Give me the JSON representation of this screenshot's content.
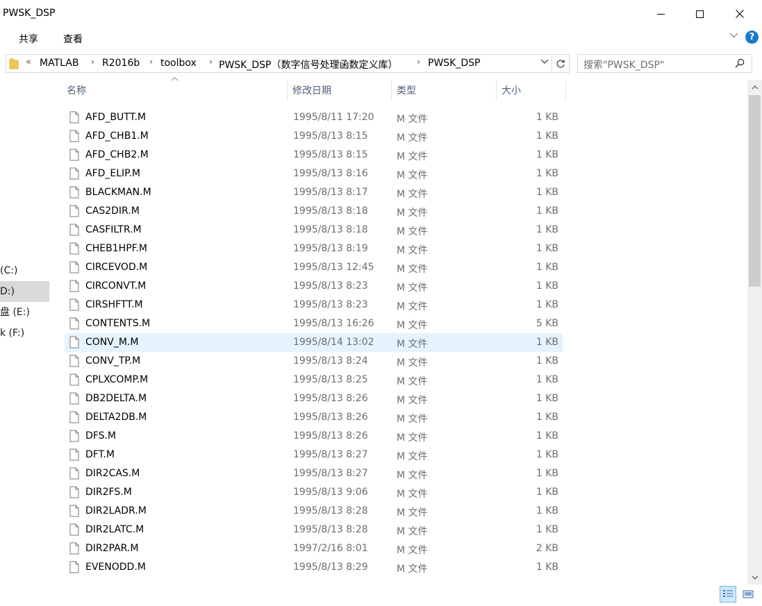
{
  "window": {
    "title": "PWSK_DSP"
  },
  "ribbon": {
    "tabs": [
      "共享",
      "查看"
    ]
  },
  "address": {
    "overflow": "«",
    "crumbs": [
      "MATLAB",
      "R2016b",
      "toolbox",
      "PWSK_DSP（数字信号处理函数定义库）",
      "PWSK_DSP"
    ]
  },
  "search": {
    "placeholder": "搜索\"PWSK_DSP\""
  },
  "nav": {
    "items": [
      {
        "label": " (C:)",
        "selected": false
      },
      {
        "label": "D:)",
        "selected": true
      },
      {
        "label": "盘 (E:)",
        "selected": false
      },
      {
        "label": "k (F:)",
        "selected": false
      }
    ]
  },
  "columns": {
    "name": "名称",
    "date": "修改日期",
    "type": "类型",
    "size": "大小"
  },
  "files": [
    {
      "name": "AFD_BUTT.M",
      "date": "1995/8/11 17:20",
      "type": "M 文件",
      "size": "1 KB"
    },
    {
      "name": "AFD_CHB1.M",
      "date": "1995/8/13 8:15",
      "type": "M 文件",
      "size": "1 KB"
    },
    {
      "name": "AFD_CHB2.M",
      "date": "1995/8/13 8:15",
      "type": "M 文件",
      "size": "1 KB"
    },
    {
      "name": "AFD_ELIP.M",
      "date": "1995/8/13 8:16",
      "type": "M 文件",
      "size": "1 KB"
    },
    {
      "name": "BLACKMAN.M",
      "date": "1995/8/13 8:17",
      "type": "M 文件",
      "size": "1 KB"
    },
    {
      "name": "CAS2DIR.M",
      "date": "1995/8/13 8:18",
      "type": "M 文件",
      "size": "1 KB"
    },
    {
      "name": "CASFILTR.M",
      "date": "1995/8/13 8:18",
      "type": "M 文件",
      "size": "1 KB"
    },
    {
      "name": "CHEB1HPF.M",
      "date": "1995/8/13 8:19",
      "type": "M 文件",
      "size": "1 KB"
    },
    {
      "name": "CIRCEVOD.M",
      "date": "1995/8/13 12:45",
      "type": "M 文件",
      "size": "1 KB"
    },
    {
      "name": "CIRCONVT.M",
      "date": "1995/8/13 8:23",
      "type": "M 文件",
      "size": "1 KB"
    },
    {
      "name": "CIRSHFTT.M",
      "date": "1995/8/13 8:23",
      "type": "M 文件",
      "size": "1 KB"
    },
    {
      "name": "CONTENTS.M",
      "date": "1995/8/13 16:26",
      "type": "M 文件",
      "size": "5 KB"
    },
    {
      "name": "CONV_M.M",
      "date": "1995/8/14 13:02",
      "type": "M 文件",
      "size": "1 KB",
      "hover": true
    },
    {
      "name": "CONV_TP.M",
      "date": "1995/8/13 8:24",
      "type": "M 文件",
      "size": "1 KB"
    },
    {
      "name": "CPLXCOMP.M",
      "date": "1995/8/13 8:25",
      "type": "M 文件",
      "size": "1 KB"
    },
    {
      "name": "DB2DELTA.M",
      "date": "1995/8/13 8:26",
      "type": "M 文件",
      "size": "1 KB"
    },
    {
      "name": "DELTA2DB.M",
      "date": "1995/8/13 8:26",
      "type": "M 文件",
      "size": "1 KB"
    },
    {
      "name": "DFS.M",
      "date": "1995/8/13 8:26",
      "type": "M 文件",
      "size": "1 KB"
    },
    {
      "name": "DFT.M",
      "date": "1995/8/13 8:27",
      "type": "M 文件",
      "size": "1 KB"
    },
    {
      "name": "DIR2CAS.M",
      "date": "1995/8/13 8:27",
      "type": "M 文件",
      "size": "1 KB"
    },
    {
      "name": "DIR2FS.M",
      "date": "1995/8/13 9:06",
      "type": "M 文件",
      "size": "1 KB"
    },
    {
      "name": "DIR2LADR.M",
      "date": "1995/8/13 8:28",
      "type": "M 文件",
      "size": "1 KB"
    },
    {
      "name": "DIR2LATC.M",
      "date": "1995/8/13 8:28",
      "type": "M 文件",
      "size": "1 KB"
    },
    {
      "name": "DIR2PAR.M",
      "date": "1997/2/16 8:01",
      "type": "M 文件",
      "size": "2 KB"
    },
    {
      "name": "EVENODD.M",
      "date": "1995/8/13 8:29",
      "type": "M 文件",
      "size": "1 KB"
    }
  ],
  "icons": {
    "file": "file-icon",
    "folder": "folder-icon",
    "search": "search-icon",
    "refresh": "refresh-icon",
    "minimize": "minimize-icon",
    "maximize": "maximize-icon",
    "close": "close-icon",
    "help": "help-icon"
  },
  "colors": {
    "accent": "#1979ca",
    "hover_row": "#e5f3ff",
    "selected_nav": "#d9d9d9",
    "header_text": "#4c607a"
  }
}
